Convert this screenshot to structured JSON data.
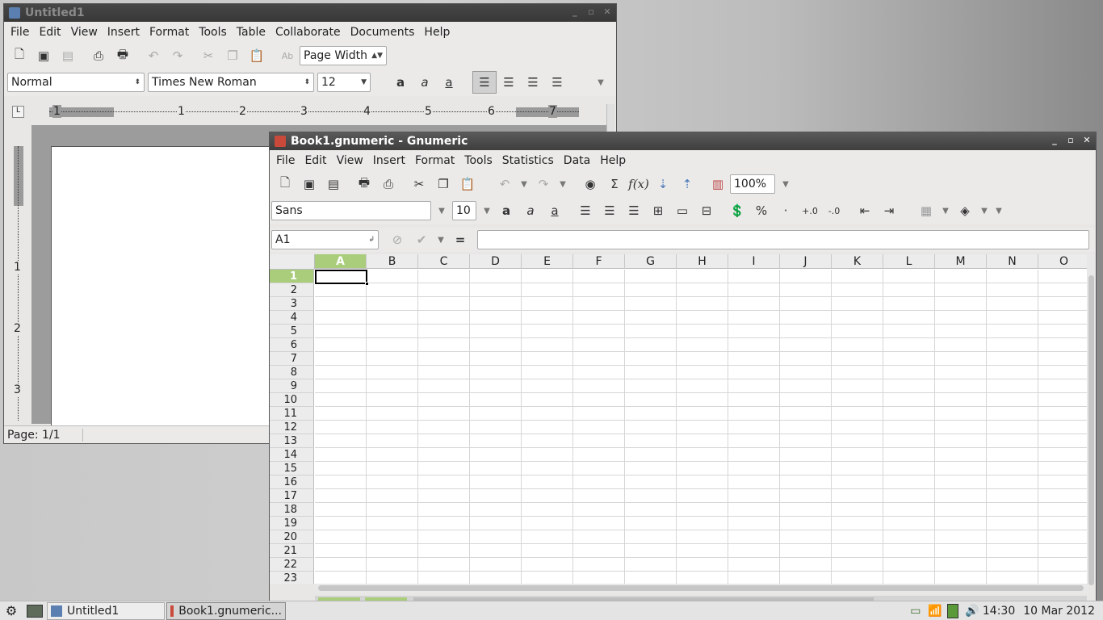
{
  "writer": {
    "title": "Untitled1",
    "menu": [
      "File",
      "Edit",
      "View",
      "Insert",
      "Format",
      "Tools",
      "Table",
      "Collaborate",
      "Documents",
      "Help"
    ],
    "zoom": "Page Width",
    "style": "Normal",
    "font": "Times New Roman",
    "size": "12",
    "ruler_marks": [
      "1",
      "1",
      "2",
      "3",
      "4",
      "5",
      "6",
      "7"
    ],
    "v_ruler_marks": [
      "1",
      "2",
      "3"
    ],
    "status": "Page: 1/1"
  },
  "gnumeric": {
    "title": "Book1.gnumeric - Gnumeric",
    "menu": [
      "File",
      "Edit",
      "View",
      "Insert",
      "Format",
      "Tools",
      "Statistics",
      "Data",
      "Help"
    ],
    "zoom": "100%",
    "font": "Sans",
    "size": "10",
    "cell_ref": "A1",
    "formula_eq": "=",
    "formula_value": "",
    "fx_label": "f(x)",
    "columns": [
      "A",
      "B",
      "C",
      "D",
      "E",
      "F",
      "G",
      "H",
      "I",
      "J",
      "K",
      "L",
      "M",
      "N",
      "O"
    ],
    "rows": [
      "1",
      "2",
      "3",
      "4",
      "5",
      "6",
      "7",
      "8",
      "9",
      "10",
      "11",
      "12",
      "13",
      "14",
      "15",
      "16",
      "17",
      "18",
      "19",
      "20",
      "21",
      "22",
      "23"
    ],
    "selected_cell": "A1"
  },
  "taskbar": {
    "tasks": [
      "Untitled1",
      "Book1.gnumeric..."
    ],
    "time": "14:30",
    "date": "10 Mar 2012"
  },
  "colors": {
    "accent": "#a9cd7a",
    "titlebar": "#3e3e3e"
  }
}
